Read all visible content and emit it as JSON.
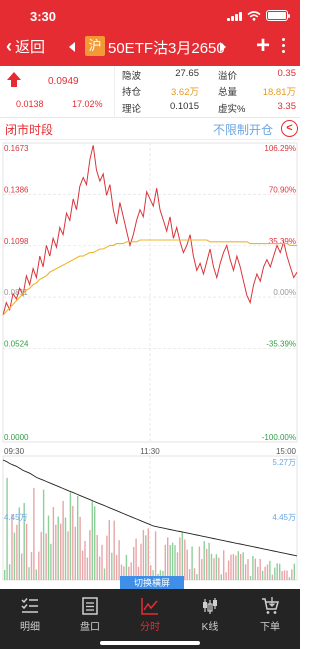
{
  "status_bar": {
    "time": "3:30"
  },
  "nav": {
    "back_label": "返回",
    "market_badge": "沪",
    "title": "50ETF沽3月2650",
    "add_label": "+",
    "colors": {
      "header_bg": "#e52c32",
      "badge_bg": "#f39a36"
    }
  },
  "quote": {
    "last_price": "0.0949",
    "change": "0.0138",
    "change_pct": "17.02%",
    "rows": [
      {
        "label1": "隐波",
        "value1": "27.65",
        "label2": "溢价",
        "value2": "0.35"
      },
      {
        "label1": "持仓",
        "value1": "3.62万",
        "label2": "总量",
        "value2": "18.81万"
      },
      {
        "label1": "理论",
        "value1": "0.1015",
        "label2": "虚实%",
        "value2": "3.35"
      }
    ]
  },
  "section": {
    "left_label": "闭市时段",
    "right_label": "不限制开仓",
    "collapse_icon": "chevron-left-icon"
  },
  "chart_data": {
    "type": "line",
    "y_left_ticks": [
      "0.1673",
      "0.1386",
      "0.1098",
      "0.0811",
      "0.0524",
      "0.0000"
    ],
    "y_right_ticks": [
      "106.29%",
      "70.90%",
      "35.39%",
      "0.00%",
      "-35.39%",
      "-100.00%"
    ],
    "x_ticks": [
      "09:30",
      "11:30",
      "15:00"
    ],
    "ylim": [
      0.0,
      0.1673
    ],
    "reference_price": 0.0811,
    "series": [
      {
        "values": [
          0.071,
          0.078,
          0.074,
          0.083,
          0.08,
          0.086,
          0.082,
          0.093,
          0.088,
          0.097,
          0.092,
          0.104,
          0.098,
          0.11,
          0.104,
          0.114,
          0.109,
          0.12,
          0.116,
          0.128,
          0.124,
          0.136,
          0.13,
          0.143,
          0.148,
          0.144,
          0.158,
          0.166,
          0.152,
          0.146,
          0.15,
          0.138,
          0.144,
          0.13,
          0.122,
          0.134,
          0.126,
          0.118,
          0.11,
          0.116,
          0.124,
          0.13,
          0.126,
          0.14,
          0.136,
          0.132,
          0.142,
          0.13,
          0.124,
          0.118,
          0.126,
          0.114,
          0.12,
          0.112,
          0.106,
          0.11,
          0.116,
          0.104,
          0.096,
          0.1,
          0.094,
          0.101,
          0.108,
          0.098,
          0.092,
          0.1,
          0.106,
          0.11,
          0.102,
          0.096,
          0.104,
          0.098,
          0.09,
          0.082,
          0.078,
          0.088,
          0.094,
          0.09,
          0.098,
          0.102,
          0.098,
          0.104,
          0.11,
          0.106,
          0.112,
          0.104,
          0.098,
          0.092,
          0.095
        ],
        "color": "#d9343b"
      },
      {
        "values": [
          0.071,
          0.073,
          0.075,
          0.077,
          0.079,
          0.081,
          0.083,
          0.085,
          0.086,
          0.088,
          0.089,
          0.091,
          0.092,
          0.093,
          0.095,
          0.096,
          0.097,
          0.098,
          0.099,
          0.1,
          0.101,
          0.102,
          0.103,
          0.104,
          0.104,
          0.105,
          0.106,
          0.106,
          0.107,
          0.108,
          0.108,
          0.109,
          0.11,
          0.11,
          0.111,
          0.111,
          0.111,
          0.112,
          0.112,
          0.112,
          0.112,
          0.113,
          0.113,
          0.113,
          0.113,
          0.113,
          0.113,
          0.113,
          0.113,
          0.113,
          0.113,
          0.113,
          0.113,
          0.113,
          0.113,
          0.113,
          0.113,
          0.113,
          0.113,
          0.113,
          0.113,
          0.113,
          0.112,
          0.112,
          0.112,
          0.112,
          0.112,
          0.112,
          0.112,
          0.112,
          0.112,
          0.112,
          0.112,
          0.112,
          0.111,
          0.111,
          0.111,
          0.111,
          0.111,
          0.111,
          0.111,
          0.111,
          0.111,
          0.111,
          0.111,
          0.111,
          0.11,
          0.11,
          0.11
        ],
        "color": "#f0b429"
      }
    ],
    "volume": {
      "right_ticks": [
        "5.27万",
        "4.45万"
      ],
      "left_tick": "4.45万",
      "open_interest": [
        5.27,
        5.25,
        5.22,
        5.2,
        5.18,
        5.15,
        5.12,
        5.1,
        5.08,
        5.05,
        5.02,
        5.0,
        4.98,
        4.96,
        4.94,
        4.92,
        4.9,
        4.88,
        4.86,
        4.84,
        4.82,
        4.8,
        4.78,
        4.76,
        4.74,
        4.72,
        4.7,
        4.68,
        4.66,
        4.64,
        4.62,
        4.6,
        4.58,
        4.56,
        4.54,
        4.52,
        4.5,
        4.48,
        4.46,
        4.44,
        4.42,
        4.4,
        4.38,
        4.36,
        4.34,
        4.32,
        4.31,
        4.3,
        4.29,
        4.28,
        4.27,
        4.26,
        4.25,
        4.24,
        4.23,
        4.22,
        4.21,
        4.2,
        4.19,
        4.18,
        4.17,
        4.16,
        4.15,
        4.14,
        4.13,
        4.12,
        4.11,
        4.1,
        4.09,
        4.08,
        4.07,
        4.06,
        4.05,
        4.04,
        4.03,
        4.02,
        4.01,
        4.0,
        3.99,
        3.98,
        3.97,
        3.96,
        3.95,
        3.94,
        3.93,
        3.92,
        3.91,
        3.9,
        3.89
      ]
    }
  },
  "toggle_label": "切换横屏",
  "tabbar": {
    "items": [
      {
        "label": "明细",
        "icon": "checklist-icon",
        "active": false
      },
      {
        "label": "盘口",
        "icon": "document-icon",
        "active": false
      },
      {
        "label": "分时",
        "icon": "line-chart-icon",
        "active": true
      },
      {
        "label": "K线",
        "icon": "candlestick-icon",
        "active": false
      },
      {
        "label": "下单",
        "icon": "cart-icon",
        "active": false
      }
    ],
    "colors": {
      "bg": "#242424",
      "active": "#e52c32",
      "inactive": "#cfcfcf"
    }
  }
}
